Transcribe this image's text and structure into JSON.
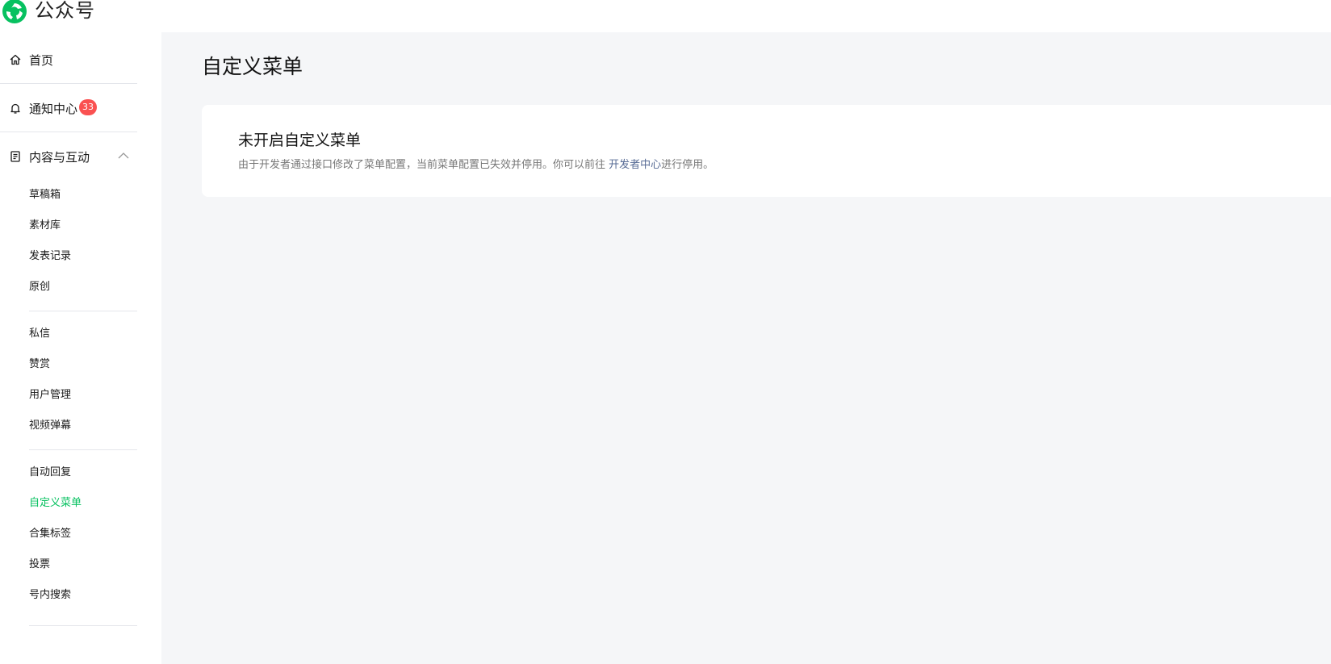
{
  "header": {
    "brand": "公众号",
    "logo_icon": "wechat-official-account-logo",
    "accent_color": "#07c160"
  },
  "sidebar": {
    "top_items": [
      {
        "label": "首页",
        "icon": "home-icon"
      },
      {
        "label": "通知中心",
        "icon": "bell-icon",
        "badge": "33"
      },
      {
        "label": "内容与互动",
        "icon": "document-icon",
        "expanded": true
      }
    ],
    "groups": [
      [
        "草稿箱",
        "素材库",
        "发表记录",
        "原创"
      ],
      [
        "私信",
        "赞赏",
        "用户管理",
        "视频弹幕"
      ],
      [
        "自动回复",
        "自定义菜单",
        "合集标签",
        "投票",
        "号内搜索"
      ]
    ],
    "active_item": "自定义菜单"
  },
  "main": {
    "page_title": "自定义菜单",
    "card": {
      "title": "未开启自定义菜单",
      "desc_prefix": "由于开发者通过接口修改了菜单配置，当前菜单配置已失效并停用。你可以前往 ",
      "desc_link": "开发者中心",
      "desc_suffix": "进行停用。"
    }
  }
}
